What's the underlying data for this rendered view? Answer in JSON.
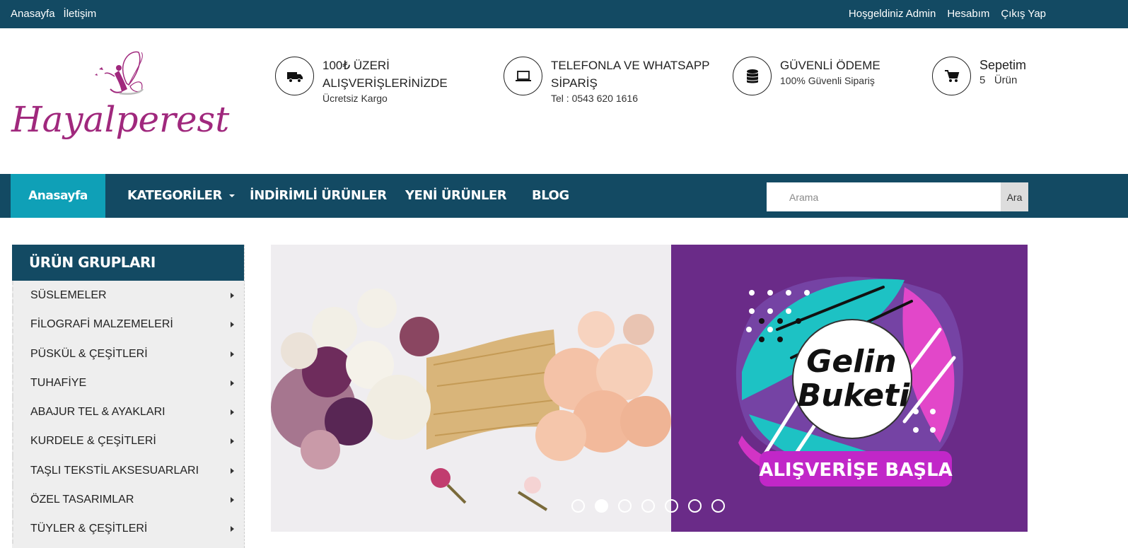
{
  "topbar": {
    "left_links": [
      "Anasayfa",
      "İletişim"
    ],
    "right_links": [
      "Hoşgeldiniz Admin",
      "Hesabım",
      "Çıkış Yap"
    ]
  },
  "logo": {
    "text": "Hayalperest",
    "color": "#a0287d"
  },
  "features": [
    {
      "icon": "truck-icon",
      "title": "100₺ ÜZERİ ALIŞVERİŞLERİNİZDE",
      "sub": "Ücretsiz Kargo"
    },
    {
      "icon": "laptop-icon",
      "title": "TELEFONLA VE WHATSAPP SİPARİŞ",
      "sub": "Tel : 0543 620 1616"
    },
    {
      "icon": "database-icon",
      "title": "GÜVENLİ ÖDEME",
      "sub": "100% Güvenli Sipariş"
    },
    {
      "icon": "cart-icon",
      "title": "Sepetim",
      "sub": "5   Ürün"
    }
  ],
  "nav": {
    "items": [
      "Anasayfa",
      "KATEGORİLER",
      "İNDİRİMLİ ÜRÜNLER",
      "YENİ ÜRÜNLER",
      "BLOG"
    ],
    "search_placeholder": "Arama",
    "search_button": "Ara"
  },
  "sidebar": {
    "title": "ÜRÜN GRUPLARI",
    "categories": [
      "SÜSLEMELER",
      "FİLOGRAFİ MALZEMELERİ",
      "PÜSKÜL & ÇEŞİTLERİ",
      "TUHAFİYE",
      "ABAJUR TEL & AYAKLARI",
      "KURDELE & ÇEŞİTLERİ",
      "TAŞLI TEKSTİL AKSESUARLARI",
      "ÖZEL TASARIMLAR",
      "TÜYLER & ÇEŞİTLERİ"
    ]
  },
  "slider": {
    "badge_line1": "Gelin",
    "badge_line2": "Buketi",
    "cta": "ALIŞVERİŞE BAŞLA",
    "dots": 7,
    "active_dot": 1
  },
  "colors": {
    "primary": "#134a63",
    "accent": "#0fa0b7",
    "purple": "#6a2b88",
    "magenta": "#c127c8"
  }
}
